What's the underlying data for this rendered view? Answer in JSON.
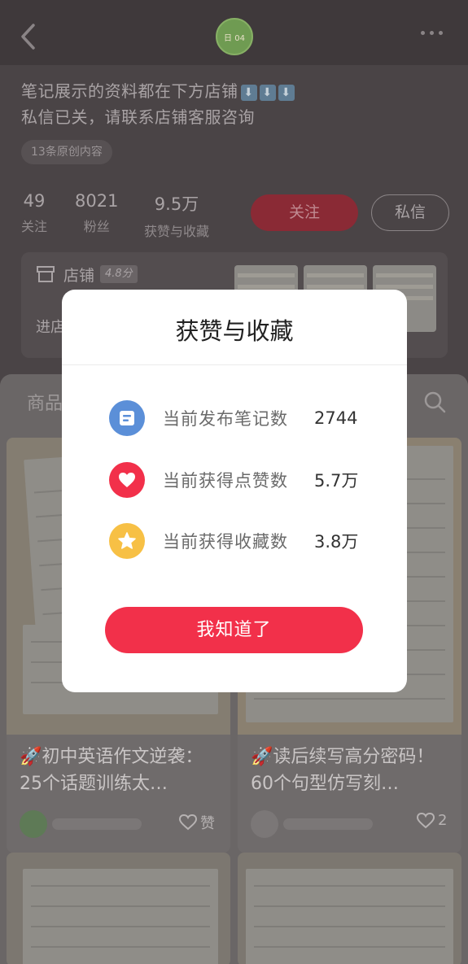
{
  "header": {
    "avatar_text": "日 04"
  },
  "profile": {
    "bio_line1": "笔记展示的资料都在下方店铺",
    "bio_line1_arrows": [
      "⬇",
      "⬇",
      "⬇"
    ],
    "bio_line2": "私信已关，请联系店铺客服咨询",
    "original_tag": "13条原创内容",
    "stats": [
      {
        "value": "49",
        "label": "关注"
      },
      {
        "value": "8021",
        "label": "粉丝"
      },
      {
        "value": "9.5万",
        "label": "获赞与收藏"
      }
    ],
    "follow_label": "关注",
    "message_label": "私信"
  },
  "store": {
    "label": "店铺",
    "score": "4.8分",
    "enter_label": "进店"
  },
  "content": {
    "tab_label": "商品",
    "cards": [
      {
        "title": "🚀初中英语作文逆袭：25个话题训练太…",
        "likes_label": "赞"
      },
      {
        "title": "🚀读后续写高分密码！60个句型仿写刻…",
        "likes_label": "2"
      }
    ]
  },
  "modal": {
    "title": "获赞与收藏",
    "rows": [
      {
        "label": "当前发布笔记数",
        "value": "2744",
        "icon": "note-icon",
        "color": "#5b8fd8"
      },
      {
        "label": "当前获得点赞数",
        "value": "5.7万",
        "icon": "heart-icon",
        "color": "#f2304a"
      },
      {
        "label": "当前获得收藏数",
        "value": "3.8万",
        "icon": "star-icon",
        "color": "#f7c045"
      }
    ],
    "button_label": "我知道了"
  }
}
